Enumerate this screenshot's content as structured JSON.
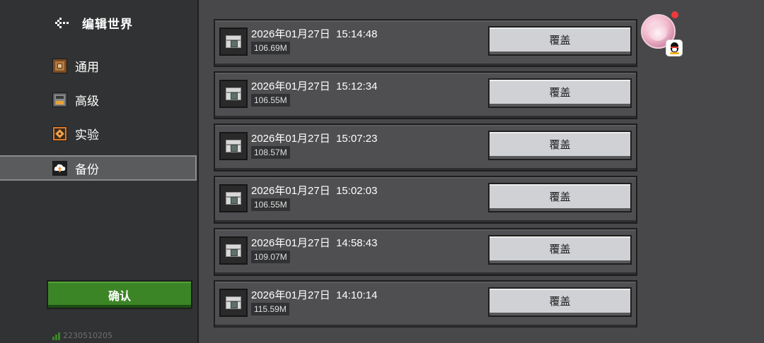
{
  "sidebar": {
    "title": "编辑世界",
    "items": [
      {
        "label": "通用",
        "icon": "command-block-icon",
        "selected": false
      },
      {
        "label": "高级",
        "icon": "furnace-icon",
        "selected": false
      },
      {
        "label": "实验",
        "icon": "experiment-block-icon",
        "selected": false
      },
      {
        "label": "备份",
        "icon": "cloud-upload-icon",
        "selected": true
      }
    ],
    "confirm_label": "确认",
    "footer_id": "2230510205"
  },
  "backups": [
    {
      "date": "2026年01月27日",
      "time": "15:14:48",
      "size": "106.69M",
      "action": "覆盖"
    },
    {
      "date": "2026年01月27日",
      "time": "15:12:34",
      "size": "106.55M",
      "action": "覆盖"
    },
    {
      "date": "2026年01月27日",
      "time": "15:07:23",
      "size": "108.57M",
      "action": "覆盖"
    },
    {
      "date": "2026年01月27日",
      "time": "15:02:03",
      "size": "106.55M",
      "action": "覆盖"
    },
    {
      "date": "2026年01月27日",
      "time": "14:58:43",
      "size": "109.07M",
      "action": "覆盖"
    },
    {
      "date": "2026年01月27日",
      "time": "14:10:14",
      "size": "115.59M",
      "action": "覆盖"
    }
  ],
  "colors": {
    "sidebar_bg": "#313233",
    "content_bg": "#48484a",
    "confirm_green": "#3c8527",
    "button_gray": "#d0d1d4",
    "notify_red": "#f0393b"
  }
}
